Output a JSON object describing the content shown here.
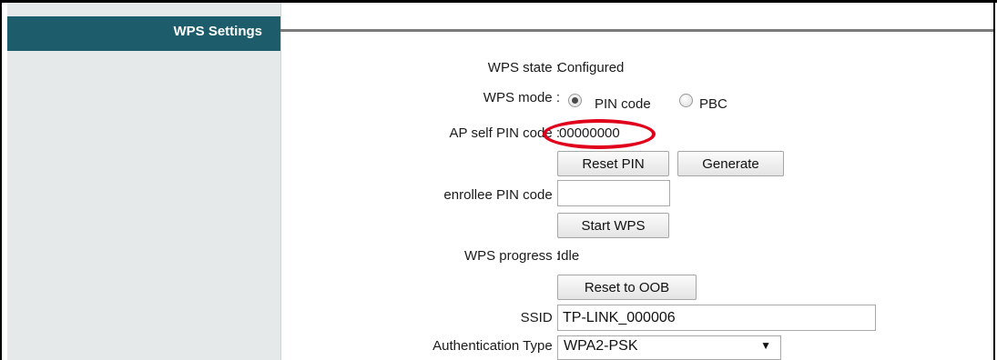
{
  "sidebar": {
    "title": "WPS Settings"
  },
  "wps_state": {
    "label": "WPS state :",
    "value": "Configured"
  },
  "wps_mode": {
    "label": "WPS mode :",
    "options": [
      {
        "label": "PIN code",
        "checked": true
      },
      {
        "label": "PBC",
        "checked": false
      }
    ]
  },
  "ap_pin": {
    "label": "AP self PIN code :",
    "value": "00000000"
  },
  "buttons": {
    "reset_pin": "Reset PIN",
    "generate": "Generate",
    "start_wps": "Start WPS",
    "reset_oob": "Reset to OOB"
  },
  "enrollee_pin": {
    "label": "enrollee PIN code :",
    "value": ""
  },
  "wps_progress": {
    "label": "WPS progress :",
    "value": "Idle"
  },
  "ssid": {
    "label": "SSID :",
    "value": "TP-LINK_000006"
  },
  "auth_type": {
    "label": "Authentication Type :",
    "value": "WPA2-PSK"
  },
  "colors": {
    "sidebar_header": "#1d5c6b",
    "highlight": "#e0001b"
  }
}
